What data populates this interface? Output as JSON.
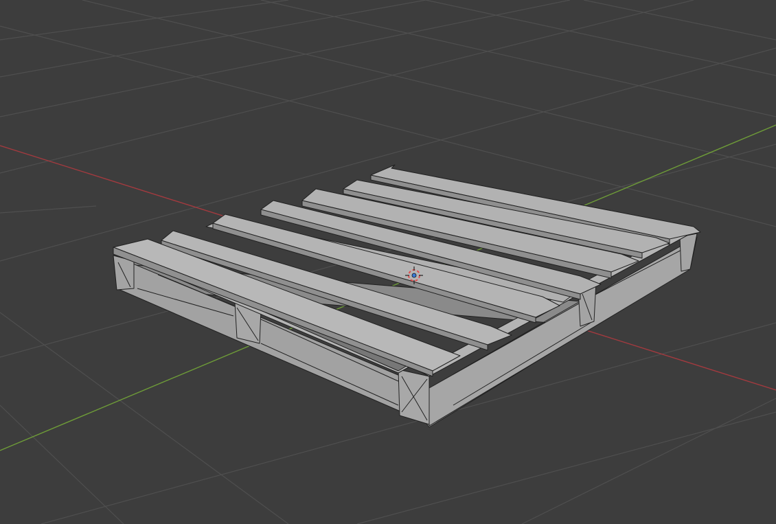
{
  "app": "3D viewport",
  "viewport": {
    "background_color": "#3d3d3d",
    "grid_color": "#4f4f4f",
    "x_axis_color": "#a33a3f",
    "y_axis_color": "#6e9c38"
  },
  "scene": {
    "object": "wooden-pallet",
    "shading": "solid-wireframe",
    "face_color": "#9d9d9d",
    "edge_color": "#202020",
    "deck_board_count": 7,
    "stringer_count": 3,
    "block_count": 9
  },
  "cursor_icon": "3d-cursor-icon",
  "origin_icon": "object-origin-icon",
  "cursor_color": "#e05050"
}
